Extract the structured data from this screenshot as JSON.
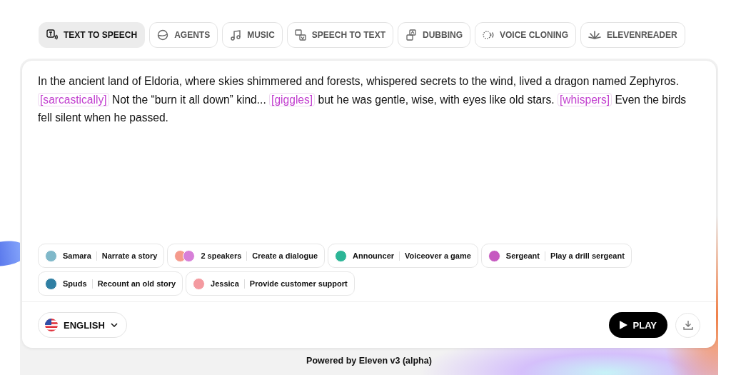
{
  "tabs": [
    {
      "label": "TEXT TO SPEECH",
      "selected": true
    },
    {
      "label": "AGENTS",
      "selected": false
    },
    {
      "label": "MUSIC",
      "selected": false
    },
    {
      "label": "SPEECH TO TEXT",
      "selected": false
    },
    {
      "label": "DUBBING",
      "selected": false
    },
    {
      "label": "VOICE CLONING",
      "selected": false
    },
    {
      "label": "ELEVENREADER",
      "selected": false
    }
  ],
  "editor": {
    "segments": [
      {
        "kind": "text",
        "text": "In the ancient land of Eldoria, where skies shimmered and forests, whispered secrets to the wind, lived a dragon named Zephyros. "
      },
      {
        "kind": "tag",
        "text": "[sarcastically]"
      },
      {
        "kind": "text",
        "text": " Not the “burn it all down” kind... "
      },
      {
        "kind": "tag",
        "text": "[giggles]"
      },
      {
        "kind": "text",
        "text": " but he was gentle, wise, with eyes like old stars. "
      },
      {
        "kind": "tag",
        "text": "[whispers]"
      },
      {
        "kind": "text",
        "text": " Even the birds fell silent when he passed."
      }
    ]
  },
  "voices": [
    {
      "name": "Samara",
      "prompt": "Narrate a story",
      "avatars": [
        {
          "color": "#7fb8c9"
        }
      ]
    },
    {
      "name": "2 speakers",
      "prompt": "Create a dialogue",
      "avatars": [
        {
          "color": "#f59a8c"
        },
        {
          "color": "#d77fd8"
        }
      ]
    },
    {
      "name": "Announcer",
      "prompt": "Voiceover a game",
      "avatars": [
        {
          "color": "#2bb596"
        }
      ]
    },
    {
      "name": "Sergeant",
      "prompt": "Play a drill sergeant",
      "avatars": [
        {
          "color": "#c658c0"
        }
      ]
    },
    {
      "name": "Spuds",
      "prompt": "Recount an old story",
      "avatars": [
        {
          "color": "#2f7fa3"
        }
      ]
    },
    {
      "name": "Jessica",
      "prompt": "Provide customer support",
      "avatars": [
        {
          "color": "#f49aa0"
        }
      ]
    }
  ],
  "language": {
    "label": "ENGLISH"
  },
  "play_button": {
    "label": "PLAY"
  },
  "footer": "Powered by Eleven v3 (alpha)"
}
